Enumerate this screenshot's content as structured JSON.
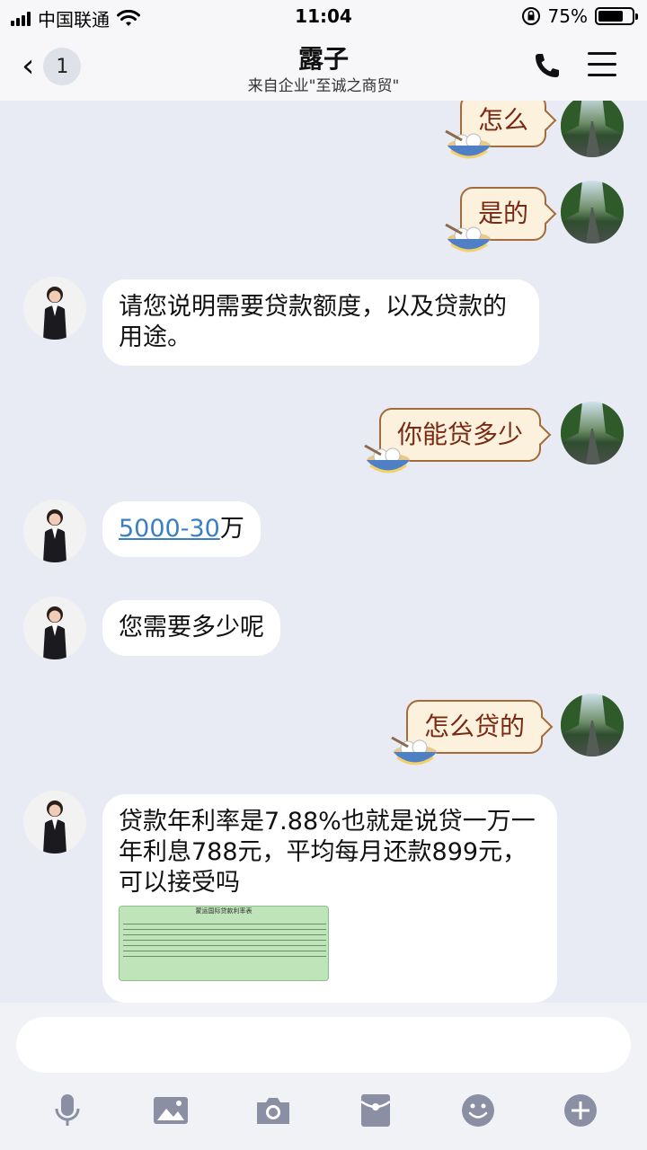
{
  "status_bar": {
    "carrier": "中国联通",
    "time": "11:04",
    "battery": "75%",
    "battery_level": 0.75
  },
  "header": {
    "back_count": "1",
    "title": "露子",
    "subtitle": "来自企业\"至诚之商贸\""
  },
  "messages": [
    {
      "side": "right",
      "type": "sticker",
      "text": "怎么"
    },
    {
      "side": "right",
      "type": "sticker",
      "text": "是的"
    },
    {
      "side": "left",
      "type": "text",
      "text": "请您说明需要贷款额度，以及贷款的用途。"
    },
    {
      "side": "right",
      "type": "sticker",
      "text": "你能贷多少"
    },
    {
      "side": "left",
      "type": "text",
      "link": "5000-30",
      "text": "万"
    },
    {
      "side": "left",
      "type": "text",
      "text": "您需要多少呢"
    },
    {
      "side": "right",
      "type": "sticker",
      "text": "怎么贷的"
    },
    {
      "side": "left",
      "type": "text_image",
      "text": "贷款年利率是7.88%也就是说贷一万一年利息788元，平均每月还款899元，可以接受吗",
      "image_title": "蒙运国际贷款利率表"
    }
  ],
  "toolbar": [
    "mic-icon",
    "image-icon",
    "camera-icon",
    "red-packet-icon",
    "emoji-icon",
    "plus-icon"
  ]
}
